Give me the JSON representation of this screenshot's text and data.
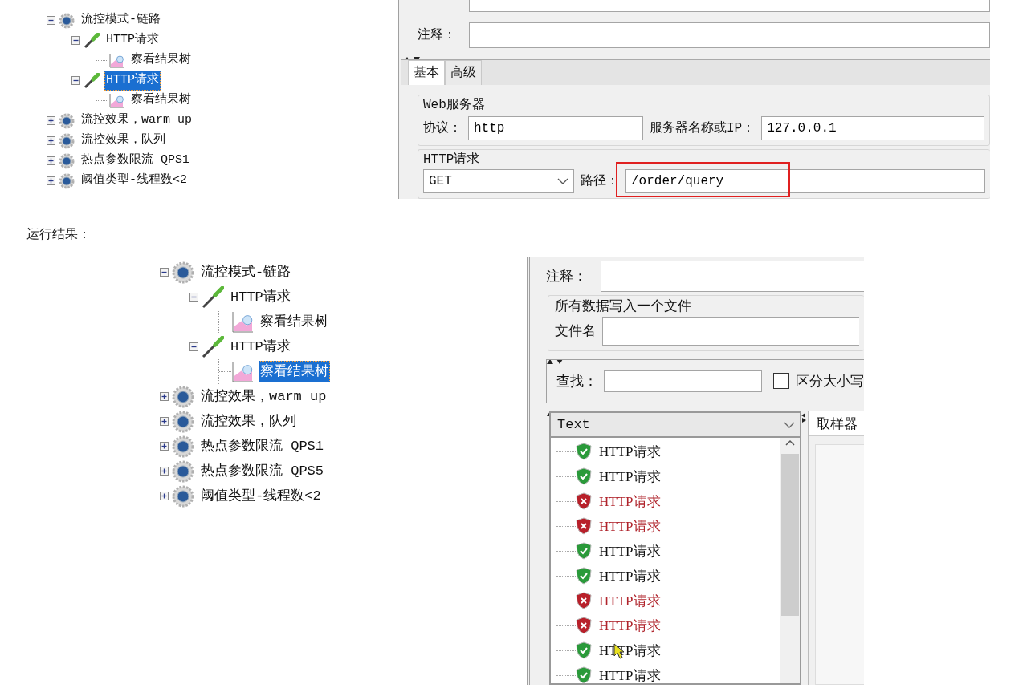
{
  "top_shot": {
    "tree": [
      {
        "label": "流控模式-链路",
        "kind": "group",
        "expanded": true,
        "selected": false,
        "children": [
          {
            "label": "HTTP请求",
            "kind": "sampler",
            "expanded": true,
            "selected": false,
            "children": [
              {
                "label": "察看结果树",
                "kind": "listener",
                "selected": false
              }
            ]
          },
          {
            "label": "HTTP请求",
            "kind": "sampler",
            "expanded": true,
            "selected": true,
            "children": [
              {
                "label": "察看结果树",
                "kind": "listener",
                "selected": false
              }
            ]
          }
        ]
      },
      {
        "label": "流控效果，warm up",
        "kind": "group",
        "expanded": false,
        "selected": false
      },
      {
        "label": "流控效果，队列",
        "kind": "group",
        "expanded": false,
        "selected": false
      },
      {
        "label": "热点参数限流 QPS1",
        "kind": "group",
        "expanded": false,
        "selected": false
      },
      {
        "label": "阈值类型-线程数<2",
        "kind": "group",
        "expanded": false,
        "selected": false
      }
    ],
    "form": {
      "comment_label": "注释：",
      "tabs": [
        {
          "label": "基本",
          "selected": true
        },
        {
          "label": "高级",
          "selected": false
        }
      ],
      "web_server": {
        "legend": "Web服务器",
        "protocol_label": "协议：",
        "protocol": "http",
        "server_label": "服务器名称或IP：",
        "server": "127.0.0.1"
      },
      "http_request": {
        "legend": "HTTP请求",
        "method": "GET",
        "path_label": "路径：",
        "path": "/order/query",
        "highlighted": true
      }
    }
  },
  "caption": "运行结果：",
  "bottom_shot": {
    "tree": [
      {
        "label": "流控模式-链路",
        "kind": "group",
        "expanded": true,
        "selected": false,
        "children": [
          {
            "label": "HTTP请求",
            "kind": "sampler",
            "expanded": true,
            "selected": false,
            "children": [
              {
                "label": "察看结果树",
                "kind": "listener",
                "selected": false
              }
            ]
          },
          {
            "label": "HTTP请求",
            "kind": "sampler",
            "expanded": true,
            "selected": false,
            "children": [
              {
                "label": "察看结果树",
                "kind": "listener",
                "selected": true
              }
            ]
          }
        ]
      },
      {
        "label": "流控效果，warm up",
        "kind": "group",
        "expanded": false,
        "selected": false
      },
      {
        "label": "流控效果，队列",
        "kind": "group",
        "expanded": false,
        "selected": false
      },
      {
        "label": "热点参数限流 QPS1",
        "kind": "group",
        "expanded": false,
        "selected": false
      },
      {
        "label": "热点参数限流 QPS5",
        "kind": "group",
        "expanded": false,
        "selected": false
      },
      {
        "label": "阈值类型-线程数<2",
        "kind": "group",
        "expanded": false,
        "selected": false
      }
    ],
    "form": {
      "comment_label": "注释：",
      "file_legend": "所有数据写入一个文件",
      "filename_label": "文件名",
      "search_label": "查找：",
      "case_label": "区分大小写",
      "case_checked": false,
      "renderer": "Text",
      "right_tab": "取样器",
      "results": [
        {
          "label": "HTTP请求",
          "success": true
        },
        {
          "label": "HTTP请求",
          "success": true
        },
        {
          "label": "HTTP请求",
          "success": false
        },
        {
          "label": "HTTP请求",
          "success": false
        },
        {
          "label": "HTTP请求",
          "success": true
        },
        {
          "label": "HTTP请求",
          "success": true
        },
        {
          "label": "HTTP请求",
          "success": false
        },
        {
          "label": "HTTP请求",
          "success": false
        },
        {
          "label": "HTTP请求",
          "success": true
        },
        {
          "label": "HTTP请求",
          "success": true
        }
      ]
    }
  }
}
